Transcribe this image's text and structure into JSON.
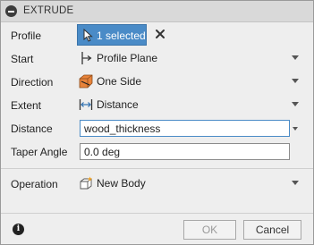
{
  "dialog": {
    "title": "EXTRUDE"
  },
  "rows": {
    "profile": {
      "label": "Profile",
      "selection_label": "1 selected"
    },
    "start": {
      "label": "Start",
      "value": "Profile Plane",
      "icon": "profile-plane-icon"
    },
    "direction": {
      "label": "Direction",
      "value": "One Side",
      "icon": "one-side-icon"
    },
    "extent": {
      "label": "Extent",
      "value": "Distance",
      "icon": "distance-icon"
    },
    "distance": {
      "label": "Distance",
      "value": "wood_thickness"
    },
    "taper": {
      "label": "Taper Angle",
      "value": "0.0 deg"
    },
    "operation": {
      "label": "Operation",
      "value": "New Body",
      "icon": "new-body-icon"
    }
  },
  "footer": {
    "ok_label": "OK",
    "cancel_label": "Cancel"
  },
  "colors": {
    "accent": "#4a8bc7",
    "background": "#eeeeee",
    "titlebar": "#d9d9d9"
  }
}
